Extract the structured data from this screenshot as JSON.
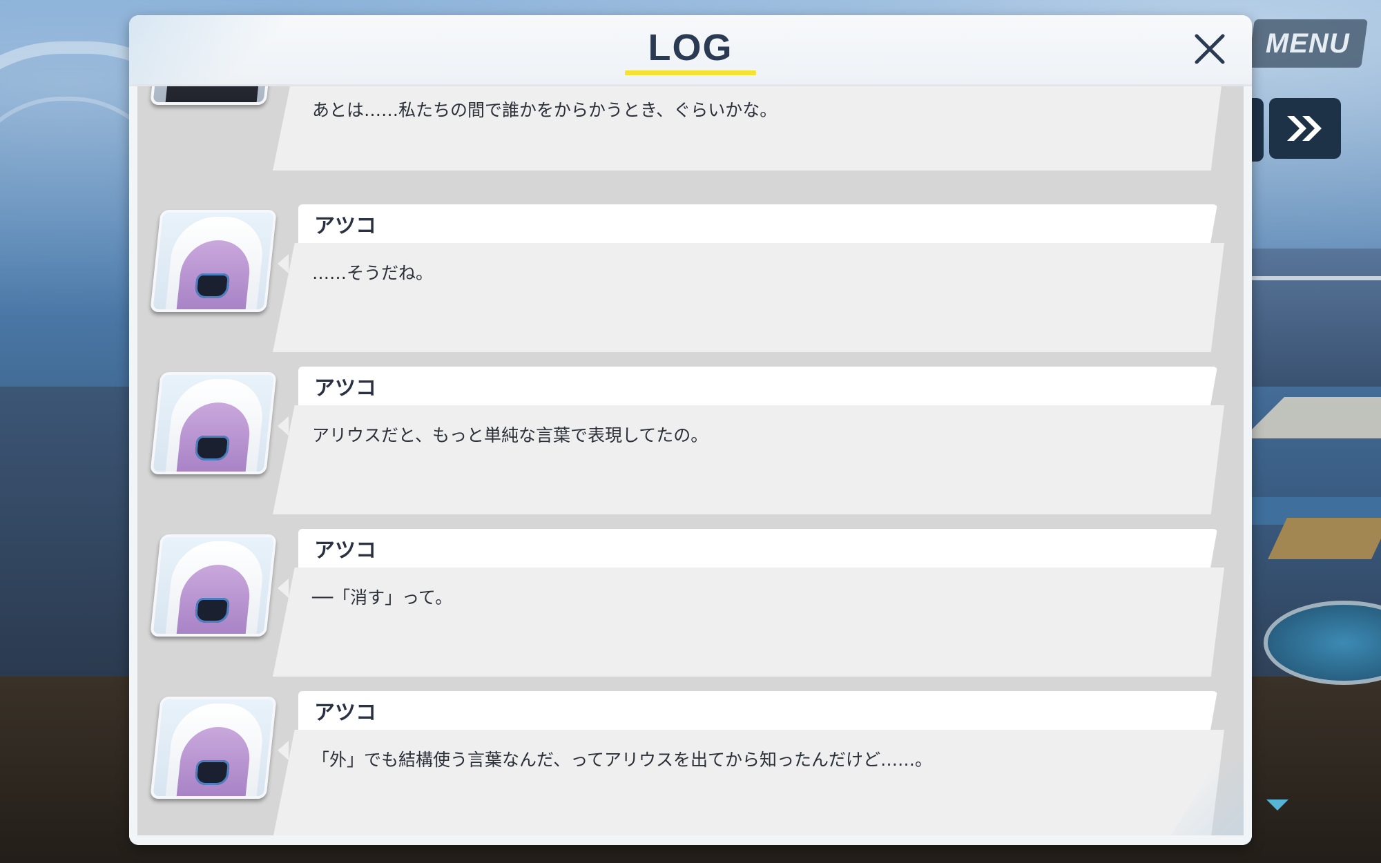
{
  "screen": {
    "title": "LOG",
    "menu_label": "MENU"
  },
  "colors": {
    "title_text": "#2a3a52",
    "title_underline": "#f3e233",
    "panel_background": "#d6d6d6",
    "bubble_background": "#efefef",
    "hud_button": "#1d3147"
  },
  "icons": {
    "close": "close-icon",
    "skip": "fast-forward-icon",
    "scroll": "triangle-down-icon"
  },
  "log": {
    "entries": [
      {
        "speaker": "",
        "text": "あとは……私たちの間で誰かをからかうとき、ぐらいかな。",
        "avatar": "dark-haired-student-portrait"
      },
      {
        "speaker": "アツコ",
        "text": "……そうだね。",
        "avatar": "atsuko-portrait"
      },
      {
        "speaker": "アツコ",
        "text": "アリウスだと、もっと単純な言葉で表現してたの。",
        "avatar": "atsuko-portrait"
      },
      {
        "speaker": "アツコ",
        "text": "──「消す」って。",
        "avatar": "atsuko-portrait"
      },
      {
        "speaker": "アツコ",
        "text": "「外」でも結構使う言葉なんだ、ってアリウスを出てから知ったんだけど……。",
        "avatar": "atsuko-portrait"
      }
    ]
  }
}
